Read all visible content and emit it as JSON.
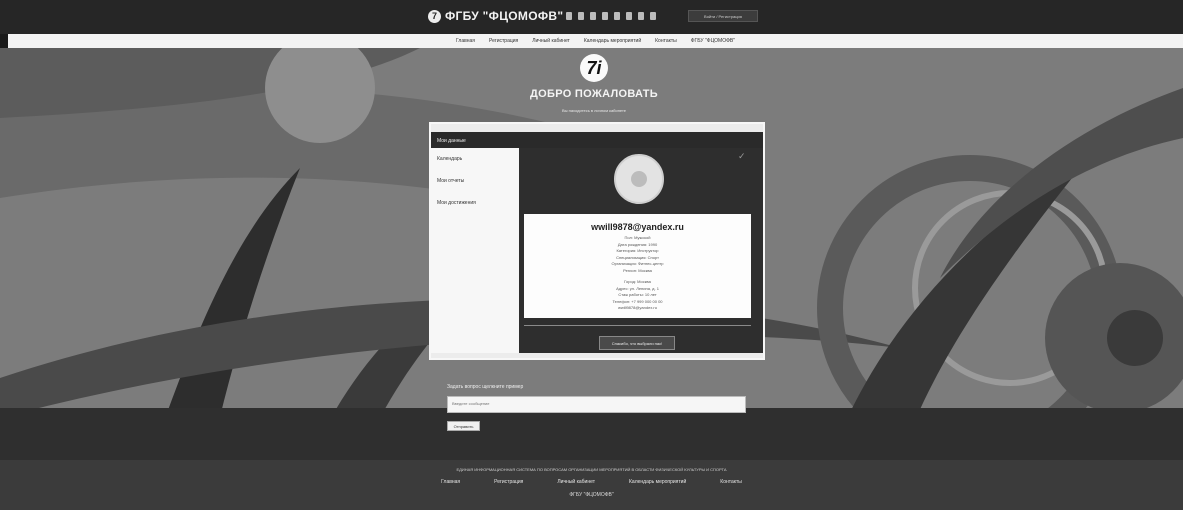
{
  "header": {
    "brand": "ФГБУ \"ФЦОМОФВ\"",
    "login_label": "Войти / Регистрация"
  },
  "nav": {
    "items": [
      "Главная",
      "Регистрация",
      "Личный кабинет",
      "Календарь мероприятий",
      "Контакты",
      "ФГБУ \"ФЦОМОФВ\""
    ]
  },
  "hero": {
    "logo_glyph": "7i",
    "title": "ДОБРО ПОЖАЛОВАТЬ",
    "subtitle": "Вы находитесь в личном кабинете"
  },
  "card": {
    "header": "Мои данные",
    "menu": [
      "Календарь",
      "Мои отчеты",
      "Мои достижения"
    ],
    "email": "wwill9878@yandex.ru",
    "info_lines_1": [
      "Пол: Мужской",
      "Дата рождения: 1990",
      "Категория: Инструктор",
      "Специализация: Спорт",
      "Организация: Фитнес-центр",
      "Регион: Москва"
    ],
    "info_lines_2": [
      "Город: Москва",
      "Адрес: ул. Ленина, д. 1",
      "Стаж работы: 10 лет",
      "Телефон: +7 999 000 00 00",
      "wwill9878@yandex.ru"
    ],
    "button_label": "Спасибо, что выбрали нас!"
  },
  "question": {
    "label": "Задать вопрос щелкните пример",
    "placeholder": "Введите сообщение",
    "send_label": "Отправить"
  },
  "footer": {
    "line": "ЕДИНАЯ ИНФОРМАЦИОННАЯ СИСТЕМА ПО ВОПРОСАМ ОРГАНИЗАЦИИ МЕРОПРИЯТИЙ В ОБЛАСТИ ФИЗИЧЕСКОЙ КУЛЬТУРЫ И СПОРТА",
    "links": [
      "Главная",
      "Регистрация",
      "Личный кабинет",
      "Календарь мероприятий",
      "Контакты"
    ],
    "brand": "ФГБУ \"ФЦОМОФВ\""
  }
}
